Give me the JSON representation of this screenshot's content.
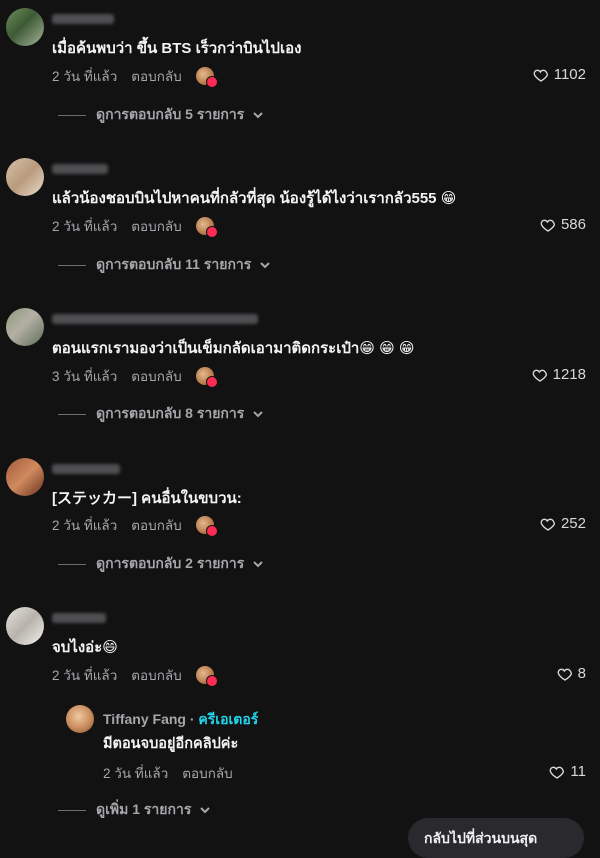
{
  "comments": [
    {
      "text": "เมื่อค้นพบว่า ขึ้น BTS เร็วกว่าบินไปเอง",
      "time": "2 วัน ที่แล้ว",
      "reply_label": "ตอบกลับ",
      "likes": "1102",
      "view_replies": "ดูการตอบกลับ 5 รายการ"
    },
    {
      "text": "แล้วน้องชอบบินไปหาคนที่กลัวที่สุด น้องรู้ได้ไงว่าเรากลัว555 😁",
      "time": "2 วัน ที่แล้ว",
      "reply_label": "ตอบกลับ",
      "likes": "586",
      "view_replies": "ดูการตอบกลับ 11 รายการ"
    },
    {
      "text": "ตอนแรกเรามองว่าเป็นเข็มกลัดเอามาติดกระเป๋า😁 😁 😁",
      "time": "3 วัน ที่แล้ว",
      "reply_label": "ตอบกลับ",
      "likes": "1218",
      "view_replies": "ดูการตอบกลับ 8 รายการ"
    },
    {
      "text": "[ステッカー] คนอื่นในขบวน:",
      "time": "2 วัน ที่แล้ว",
      "reply_label": "ตอบกลับ",
      "likes": "252",
      "view_replies": "ดูการตอบกลับ 2 รายการ"
    },
    {
      "text": "จบไงอ่ะ😄",
      "time": "2 วัน ที่แล้ว",
      "reply_label": "ตอบกลับ",
      "likes": "8",
      "reply": {
        "name": "Tiffany Fang",
        "separator": " · ",
        "badge": "ครีเอเตอร์",
        "text": "มีตอนจบอยู่อีกคลิปค่ะ",
        "time": "2 วัน ที่แล้ว",
        "reply_label": "ตอบกลับ",
        "likes": "11"
      },
      "view_more": "ดูเพิ่ม 1 รายการ"
    }
  ],
  "floating_button": "กลับไปที่ส่วนบนสุด",
  "colors": {
    "background": "#121212",
    "creator_badge": "#20d5ec",
    "like_badge": "#fe2c55"
  },
  "icons": [
    "heart-icon",
    "chevron-down-icon",
    "creator-liked-icon"
  ]
}
